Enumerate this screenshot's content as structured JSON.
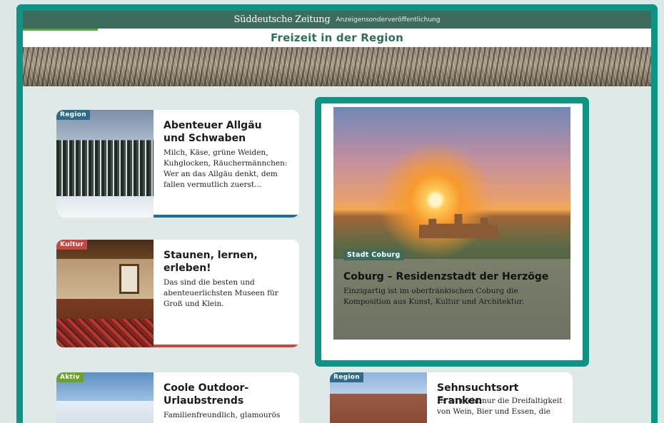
{
  "header": {
    "brand": "Süddeutsche Zeitung",
    "brand_sub": "Anzeigensonderveröffentlichung",
    "page_title": "Freizeit in der Region"
  },
  "cards": [
    {
      "tag": "Region",
      "tag_color": "#2f6a8a",
      "bar_color": "#1f6e9a",
      "title": "Abenteuer Allgäu und Schwaben",
      "text": "Milch, Käse, grüne Weiden, Kuhglocken, Räuchermännchen: Wer an das Allgäu denkt, dem fallen vermutlich zuerst..."
    },
    {
      "tag": "Kultur",
      "tag_color": "#c9453f",
      "bar_color": "#c9453f",
      "title": "Staunen, lernen, erleben!",
      "text": "Das sind die besten und abenteuerlichsten Museen für Groß und Klein."
    },
    {
      "tag": "Aktiv",
      "tag_color": "#6ea12e",
      "title": "Coole Outdoor-Urlaubstrends",
      "text": "Familienfreundlich, glamourös"
    },
    {
      "tag": "Region",
      "tag_color": "#2f6a8a",
      "title": "Sehnsuchtsort Franken",
      "text": "Es ist nicht nur die Dreifaltigkeit von Wein, Bier und Essen, die"
    }
  ],
  "featured": {
    "tag": "Stadt Coburg",
    "title": "Coburg – Residenzstadt der Herzöge",
    "text": "Einzigartig ist im oberfränkischen Coburg die Komposition aus Kunst, Kultur und Architektur."
  },
  "colors": {
    "frame": "#0e9484",
    "topbar": "#3d6b5e",
    "title_green": "#2f6e5c"
  }
}
